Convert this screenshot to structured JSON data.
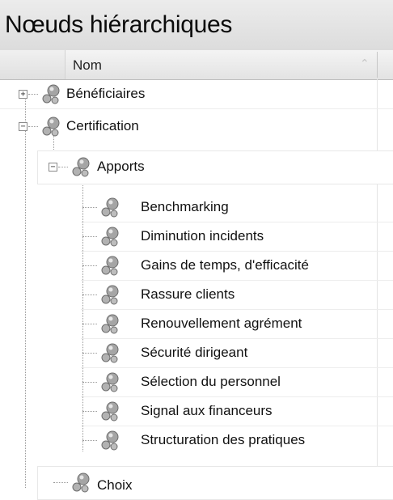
{
  "panel": {
    "title": "Nœuds hiérarchiques"
  },
  "columns": {
    "name_header": "Nom"
  },
  "tree": {
    "top_level": [
      {
        "label": "Bénéficiaires",
        "expanded": false,
        "toggle": "+"
      },
      {
        "label": "Certification",
        "expanded": true,
        "toggle": "−"
      }
    ],
    "certification": {
      "child": {
        "label": "Apports",
        "expanded": true,
        "toggle": "−"
      },
      "apports_children": [
        "Benchmarking",
        "Diminution incidents",
        "Gains de temps, d'efficacité",
        "Rassure clients",
        "Renouvellement agrément",
        "Sécurité dirigeant",
        "Sélection du personnel",
        "Signal aux financeurs",
        "Structuration des pratiques"
      ],
      "next_sibling_partial": "Choix"
    }
  },
  "colors": {
    "header_bg": "#e4e4e4",
    "icon_gray": "#9a9a9a",
    "toggle_border": "#8a8a8a"
  }
}
